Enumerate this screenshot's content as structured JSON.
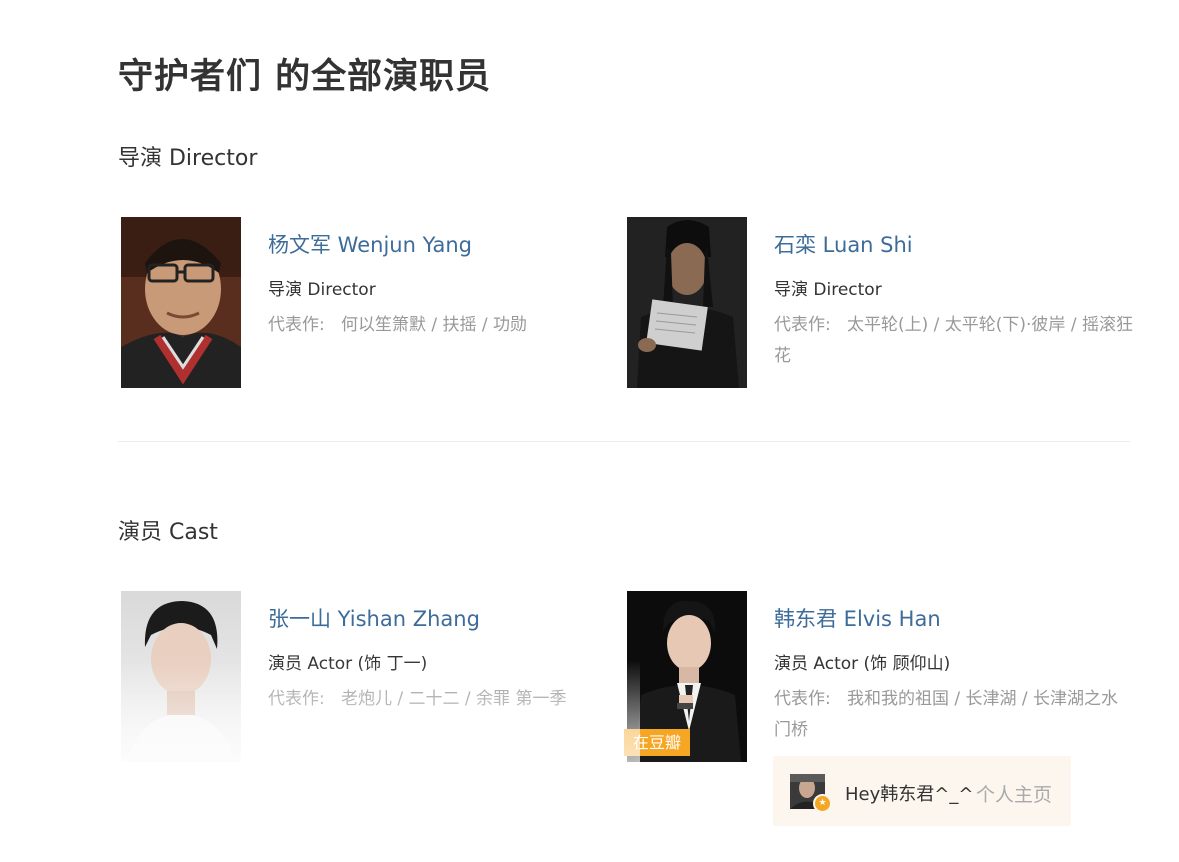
{
  "page": {
    "title": "守护者们 的全部演职员"
  },
  "directors": {
    "heading": "导演 Director",
    "people": [
      {
        "name": "杨文军 Wenjun Yang",
        "role": "导演 Director",
        "works_label": "代表作:",
        "works": [
          "何以笙箫默",
          "扶摇",
          "功勋"
        ]
      },
      {
        "name": "石栾 Luan Shi",
        "role": "导演 Director",
        "works_label": "代表作:",
        "works": [
          "太平轮(上)",
          "太平轮(下)·彼岸",
          "摇滚狂花"
        ]
      }
    ]
  },
  "cast": {
    "heading": "演员 Cast",
    "people": [
      {
        "name": "张一山 Yishan Zhang",
        "role": "演员 Actor (饰 丁一)",
        "works_label": "代表作:",
        "works": [
          "老炮儿",
          "二十二",
          "余罪 第一季"
        ]
      },
      {
        "name": "韩东君 Elvis Han",
        "role": "演员 Actor (饰 顾仰山)",
        "works_label": "代表作:",
        "works": [
          "我和我的祖国",
          "长津湖",
          "长津湖之水门桥"
        ],
        "badge": "在豆瓣"
      }
    ]
  },
  "popup": {
    "greeting": "Hey韩东君^_^",
    "home_link": "个人主页"
  },
  "colors": {
    "link": "#3d6c9a",
    "muted": "#999999",
    "badge": "#f5a623",
    "popup_bg": "#fdf6ee"
  }
}
